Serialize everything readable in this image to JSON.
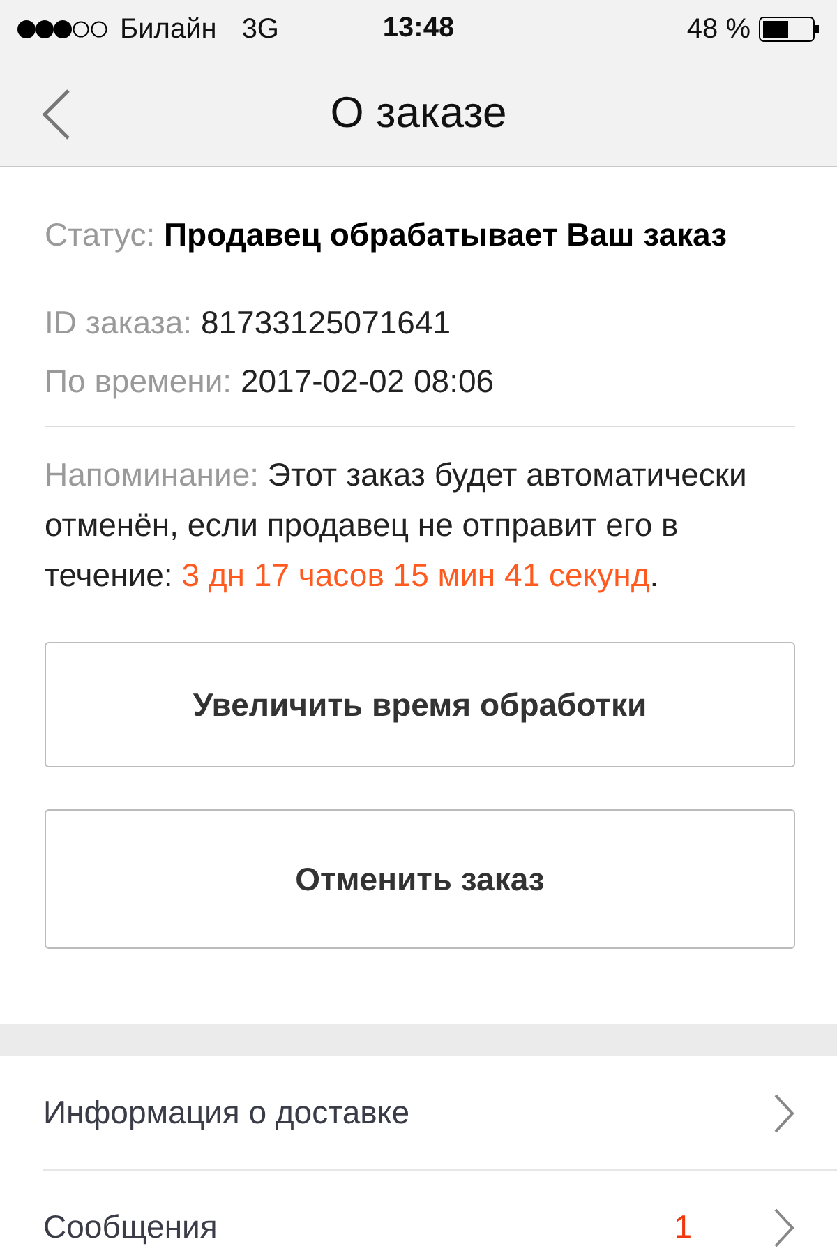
{
  "status_bar": {
    "carrier": "Билайн",
    "network": "3G",
    "time": "13:48",
    "battery": "48 %"
  },
  "nav": {
    "title": "О заказе"
  },
  "order": {
    "status": {
      "label": "Статус:",
      "value": "Продавец обрабатывает Ваш заказ"
    },
    "fields": [
      {
        "label": "ID заказа:",
        "value": "81733125071641"
      },
      {
        "label": "По времени:",
        "value": "2017-02-02 08:06"
      }
    ],
    "reminder": {
      "label": "Напоминание:",
      "text": "Этот заказ будет автоматически отменён, если продавец не отправит его в течение:",
      "countdown": "3 дн 17 часов 15 мин 41 секунд",
      "end": "."
    },
    "buttons": [
      "Увеличить время обработки",
      "Отменить заказ"
    ]
  },
  "menu": [
    {
      "label": "Информация о доставке"
    },
    {
      "label": "Сообщения",
      "count": "1"
    }
  ]
}
